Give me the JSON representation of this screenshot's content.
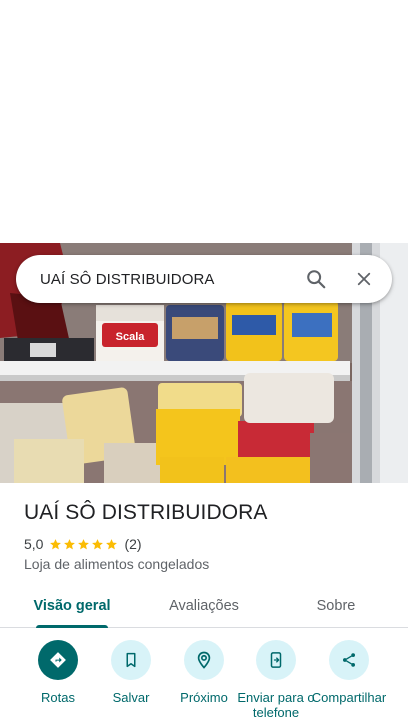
{
  "search": {
    "query": "UAÍ SÔ DISTRIBUIDORA",
    "search_icon": "search-icon",
    "close_icon": "close-icon"
  },
  "place": {
    "name": "UAÍ SÔ DISTRIBUIDORA",
    "rating": "5,0",
    "stars": 5,
    "review_count": "(2)",
    "category": "Loja de alimentos congelados"
  },
  "photo": {
    "brand_text": "Scala"
  },
  "tabs": [
    {
      "label": "Visão geral",
      "active": true
    },
    {
      "label": "Avaliações",
      "active": false
    },
    {
      "label": "Sobre",
      "active": false
    }
  ],
  "actions": [
    {
      "label": "Rotas",
      "icon": "directions-icon"
    },
    {
      "label": "Salvar",
      "icon": "bookmark-icon"
    },
    {
      "label": "Próximo",
      "icon": "nearby-icon"
    },
    {
      "label": "Enviar para o telefone",
      "icon": "send-to-phone-icon"
    },
    {
      "label": "Compartilhar",
      "icon": "share-icon"
    }
  ],
  "colors": {
    "accent": "#00696b",
    "action_bg": "#d8f3f8",
    "star": "#fbbc04"
  }
}
